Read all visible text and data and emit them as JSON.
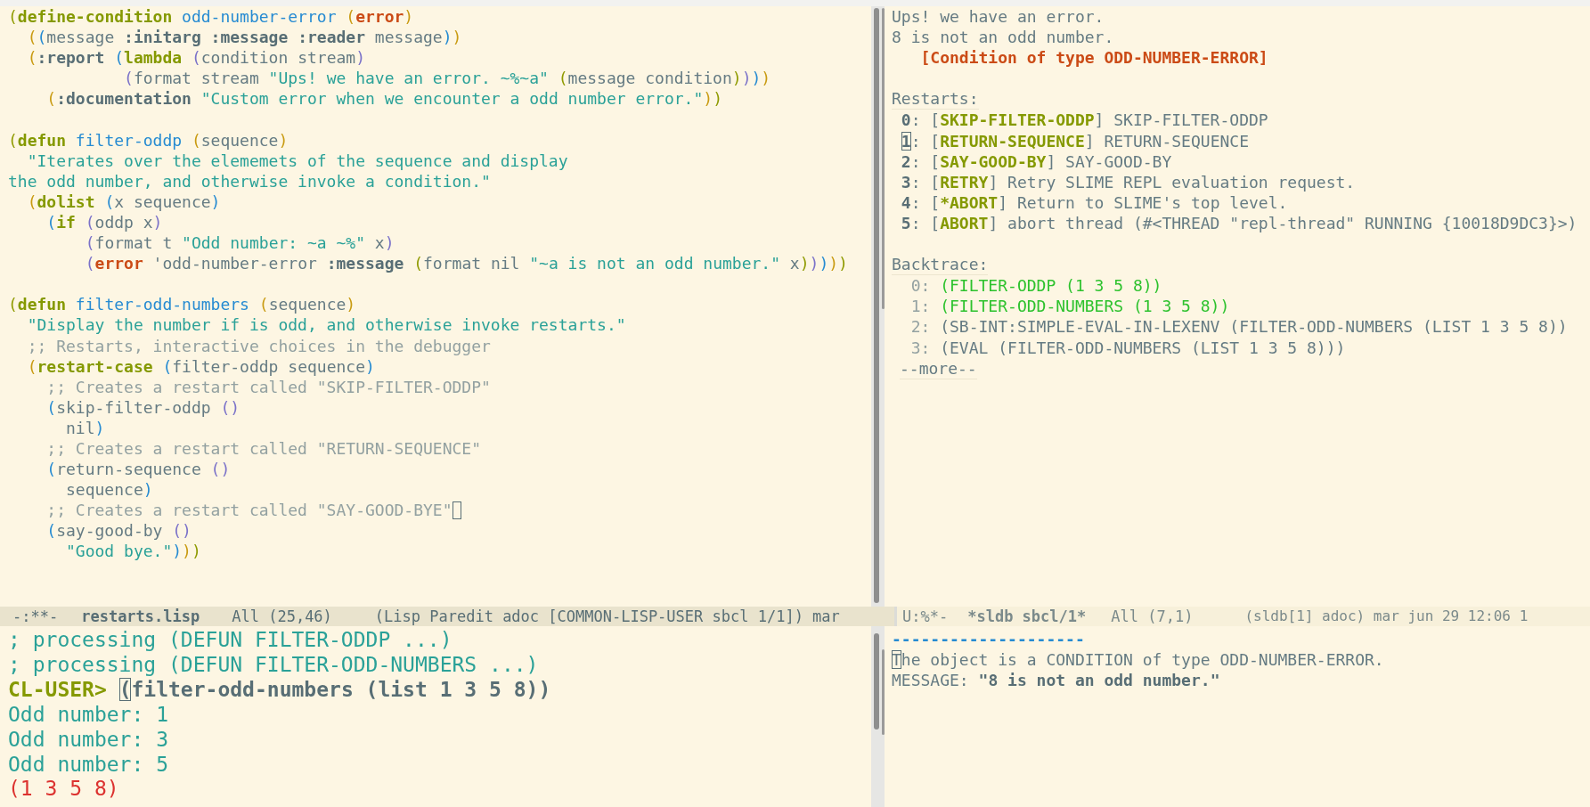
{
  "editor": {
    "lines": [
      {
        "kind": "code",
        "segments": [
          {
            "text": "(",
            "kind": "p1"
          },
          {
            "text": "define-condition",
            "kind": "kw"
          },
          {
            "text": " odd-number-error ",
            "kind": "fn"
          },
          {
            "text": "(",
            "kind": "p2"
          },
          {
            "text": "error",
            "kind": "err"
          },
          {
            "text": ")",
            "kind": "p2"
          }
        ]
      },
      {
        "kind": "code",
        "segments": [
          {
            "text": "  (",
            "kind": "p2"
          },
          {
            "text": "(",
            "kind": "p3"
          },
          {
            "text": "message ",
            "kind": "p"
          },
          {
            "text": ":initarg :message :reader",
            "kind": "key"
          },
          {
            "text": " message",
            "kind": "p"
          },
          {
            "text": ")",
            "kind": "p3"
          },
          {
            "text": ")",
            "kind": "p2"
          }
        ]
      },
      {
        "kind": "code",
        "segments": [
          {
            "text": "  (",
            "kind": "p2"
          },
          {
            "text": ":report ",
            "kind": "key"
          },
          {
            "text": "(",
            "kind": "p3"
          },
          {
            "text": "lambda ",
            "kind": "kw"
          },
          {
            "text": "(",
            "kind": "p4"
          },
          {
            "text": "condition stream",
            "kind": "p"
          },
          {
            "text": ")",
            "kind": "p4"
          }
        ]
      },
      {
        "kind": "code",
        "segments": [
          {
            "text": "            (",
            "kind": "p4"
          },
          {
            "text": "format stream ",
            "kind": "p"
          },
          {
            "text": "\"Ups! we have an error. ~%~a\" ",
            "kind": "str"
          },
          {
            "text": "(",
            "kind": "p1"
          },
          {
            "text": "message condition",
            "kind": "p"
          },
          {
            "text": ")",
            "kind": "p1"
          },
          {
            "text": ")",
            "kind": "p4"
          },
          {
            "text": ")",
            "kind": "p3"
          },
          {
            "text": ")",
            "kind": "p2"
          }
        ]
      },
      {
        "kind": "code",
        "segments": [
          {
            "text": "    (",
            "kind": "p2"
          },
          {
            "text": ":documentation ",
            "kind": "key"
          },
          {
            "text": "\"Custom error when we encounter a odd number error.\"",
            "kind": "str"
          },
          {
            "text": ")",
            "kind": "p2"
          },
          {
            "text": ")",
            "kind": "p1"
          }
        ]
      },
      {
        "kind": "blank"
      },
      {
        "kind": "code",
        "segments": [
          {
            "text": "(",
            "kind": "p1"
          },
          {
            "text": "defun",
            "kind": "kw"
          },
          {
            "text": " filter-oddp ",
            "kind": "fn"
          },
          {
            "text": "(",
            "kind": "p2"
          },
          {
            "text": "sequence",
            "kind": "p"
          },
          {
            "text": ")",
            "kind": "p2"
          }
        ]
      },
      {
        "kind": "code",
        "segments": [
          {
            "text": "  \"Iterates over the elememets of the sequence and display",
            "kind": "str"
          }
        ]
      },
      {
        "kind": "code",
        "segments": [
          {
            "text": "the odd number, and otherwise invoke a condition.\"",
            "kind": "str"
          }
        ]
      },
      {
        "kind": "code",
        "segments": [
          {
            "text": "  (",
            "kind": "p2"
          },
          {
            "text": "dolist ",
            "kind": "kw"
          },
          {
            "text": "(",
            "kind": "p3"
          },
          {
            "text": "x sequence",
            "kind": "p"
          },
          {
            "text": ")",
            "kind": "p3"
          }
        ]
      },
      {
        "kind": "code",
        "segments": [
          {
            "text": "    (",
            "kind": "p3"
          },
          {
            "text": "if ",
            "kind": "kw"
          },
          {
            "text": "(",
            "kind": "p4"
          },
          {
            "text": "oddp x",
            "kind": "p"
          },
          {
            "text": ")",
            "kind": "p4"
          }
        ]
      },
      {
        "kind": "code",
        "segments": [
          {
            "text": "        (",
            "kind": "p4"
          },
          {
            "text": "format t ",
            "kind": "p"
          },
          {
            "text": "\"Odd number: ~a ~%\"",
            "kind": "str"
          },
          {
            "text": " x",
            "kind": "p"
          },
          {
            "text": ")",
            "kind": "p4"
          }
        ]
      },
      {
        "kind": "code",
        "segments": [
          {
            "text": "        (",
            "kind": "p4"
          },
          {
            "text": "error",
            "kind": "err"
          },
          {
            "text": " 'odd-number-error ",
            "kind": "p"
          },
          {
            "text": ":message ",
            "kind": "key"
          },
          {
            "text": "(",
            "kind": "p1"
          },
          {
            "text": "format nil ",
            "kind": "p"
          },
          {
            "text": "\"~a is not an odd number.\"",
            "kind": "str"
          },
          {
            "text": " x",
            "kind": "p"
          },
          {
            "text": ")",
            "kind": "p1"
          },
          {
            "text": ")",
            "kind": "p4"
          },
          {
            "text": ")",
            "kind": "p3"
          },
          {
            "text": ")",
            "kind": "p2"
          },
          {
            "text": ")",
            "kind": "p1"
          }
        ]
      },
      {
        "kind": "blank"
      },
      {
        "kind": "code",
        "segments": [
          {
            "text": "(",
            "kind": "p1"
          },
          {
            "text": "defun",
            "kind": "kw"
          },
          {
            "text": " filter-odd-numbers ",
            "kind": "fn"
          },
          {
            "text": "(",
            "kind": "p2"
          },
          {
            "text": "sequence",
            "kind": "p"
          },
          {
            "text": ")",
            "kind": "p2"
          }
        ]
      },
      {
        "kind": "code",
        "segments": [
          {
            "text": "  \"Display the number if is odd, and otherwise invoke restarts.\"",
            "kind": "str"
          }
        ]
      },
      {
        "kind": "code",
        "segments": [
          {
            "text": "  ;; Restarts, interactive choices in the debugger",
            "kind": "cm"
          }
        ]
      },
      {
        "kind": "code",
        "segments": [
          {
            "text": "  (",
            "kind": "p2"
          },
          {
            "text": "restart-case ",
            "kind": "kw"
          },
          {
            "text": "(",
            "kind": "p3"
          },
          {
            "text": "filter-oddp sequence",
            "kind": "p"
          },
          {
            "text": ")",
            "kind": "p3"
          }
        ]
      },
      {
        "kind": "code",
        "segments": [
          {
            "text": "    ;; Creates a restart called \"SKIP-FILTER-ODDP\"",
            "kind": "cm"
          }
        ]
      },
      {
        "kind": "code",
        "segments": [
          {
            "text": "    (",
            "kind": "p3"
          },
          {
            "text": "skip-filter-oddp ",
            "kind": "p"
          },
          {
            "text": "()",
            "kind": "p4"
          }
        ]
      },
      {
        "kind": "code",
        "segments": [
          {
            "text": "      nil",
            "kind": "p"
          },
          {
            "text": ")",
            "kind": "p3"
          }
        ]
      },
      {
        "kind": "code",
        "segments": [
          {
            "text": "    ;; Creates a restart called \"RETURN-SEQUENCE\"",
            "kind": "cm"
          }
        ]
      },
      {
        "kind": "code",
        "segments": [
          {
            "text": "    (",
            "kind": "p3"
          },
          {
            "text": "return-sequence ",
            "kind": "p"
          },
          {
            "text": "()",
            "kind": "p4"
          }
        ]
      },
      {
        "kind": "code",
        "segments": [
          {
            "text": "      sequence",
            "kind": "p"
          },
          {
            "text": ")",
            "kind": "p3"
          }
        ]
      },
      {
        "kind": "code",
        "cursor_after": true,
        "segments": [
          {
            "text": "    ;; Creates a restart called \"SAY-GOOD-BYE\"",
            "kind": "cm"
          }
        ]
      },
      {
        "kind": "code",
        "segments": [
          {
            "text": "    (",
            "kind": "p3"
          },
          {
            "text": "say-good-by ",
            "kind": "p"
          },
          {
            "text": "()",
            "kind": "p4"
          }
        ]
      },
      {
        "kind": "code",
        "segments": [
          {
            "text": "      \"Good bye.\"",
            "kind": "str"
          },
          {
            "text": ")",
            "kind": "p3"
          },
          {
            "text": ")",
            "kind": "p2"
          },
          {
            "text": ")",
            "kind": "p1"
          }
        ]
      }
    ]
  },
  "debugger": {
    "lines": [
      {
        "kind": "text",
        "segments": [
          {
            "text": "Ups! we have an error.",
            "kind": "p"
          }
        ]
      },
      {
        "kind": "text",
        "segments": [
          {
            "text": "8 is not an odd number.",
            "kind": "p"
          }
        ]
      },
      {
        "kind": "text",
        "segments": [
          {
            "text": "   [Condition of type ODD-NUMBER-ERROR]",
            "kind": "cond"
          }
        ]
      },
      {
        "kind": "blank"
      },
      {
        "kind": "heading",
        "segments": [
          {
            "text": "Restarts:",
            "kind": "p"
          }
        ]
      },
      {
        "kind": "restart",
        "segments": [
          {
            "text": "0",
            "kind": "num"
          },
          {
            "text": ": [",
            "kind": "p"
          },
          {
            "text": "SKIP-FILTER-ODDP",
            "kind": "rname"
          },
          {
            "text": "] SKIP-FILTER-ODDP",
            "kind": "p"
          }
        ]
      },
      {
        "kind": "restart",
        "segments": [
          {
            "text": "1",
            "kind": "curb"
          },
          {
            "text": ": [",
            "kind": "p"
          },
          {
            "text": "RETURN-SEQUENCE",
            "kind": "rname"
          },
          {
            "text": "] RETURN-SEQUENCE",
            "kind": "p"
          }
        ]
      },
      {
        "kind": "restart",
        "segments": [
          {
            "text": "2",
            "kind": "num"
          },
          {
            "text": ": [",
            "kind": "p"
          },
          {
            "text": "SAY-GOOD-BY",
            "kind": "rname"
          },
          {
            "text": "] SAY-GOOD-BY",
            "kind": "p"
          }
        ]
      },
      {
        "kind": "restart",
        "segments": [
          {
            "text": "3",
            "kind": "num"
          },
          {
            "text": ": [",
            "kind": "p"
          },
          {
            "text": "RETRY",
            "kind": "rname"
          },
          {
            "text": "] Retry SLIME REPL evaluation request.",
            "kind": "p"
          }
        ]
      },
      {
        "kind": "restart",
        "segments": [
          {
            "text": "4",
            "kind": "num"
          },
          {
            "text": ": [",
            "kind": "p"
          },
          {
            "text": "*ABORT",
            "kind": "rname"
          },
          {
            "text": "] Return to SLIME's top level.",
            "kind": "p"
          }
        ]
      },
      {
        "kind": "restart",
        "segments": [
          {
            "text": "5",
            "kind": "num"
          },
          {
            "text": ": [",
            "kind": "p"
          },
          {
            "text": "ABORT",
            "kind": "rname"
          },
          {
            "text": "] abort thread (#<THREAD \"repl-thread\" RUNNING {10018D9DC3}>)",
            "kind": "p"
          }
        ]
      },
      {
        "kind": "blank"
      },
      {
        "kind": "heading",
        "segments": [
          {
            "text": "Backtrace:",
            "kind": "p"
          }
        ]
      },
      {
        "kind": "frame",
        "segments": [
          {
            "text": "  0: ",
            "kind": "fnum"
          },
          {
            "text": "(FILTER-ODDP (1 3 5 8))",
            "kind": "live"
          }
        ]
      },
      {
        "kind": "frame",
        "segments": [
          {
            "text": "  1: ",
            "kind": "fnum"
          },
          {
            "text": "(FILTER-ODD-NUMBERS (1 3 5 8))",
            "kind": "live"
          }
        ]
      },
      {
        "kind": "frame",
        "segments": [
          {
            "text": "  2: ",
            "kind": "fnum"
          },
          {
            "text": "(SB-INT:SIMPLE-EVAL-IN-LEXENV (FILTER-ODD-NUMBERS (LIST 1 3 5 8))",
            "kind": "p"
          }
        ]
      },
      {
        "kind": "frame",
        "segments": [
          {
            "text": "  3: ",
            "kind": "fnum"
          },
          {
            "text": "(EVAL (FILTER-ODD-NUMBERS (LIST 1 3 5 8)))",
            "kind": "p"
          }
        ]
      },
      {
        "kind": "more",
        "segments": [
          {
            "text": "--more--",
            "kind": "p"
          }
        ]
      }
    ]
  },
  "editor_mode_line": {
    "active": true,
    "state": "-:**-",
    "buffer": "restarts.lisp",
    "position": "All (25,46)",
    "modes": "(Lisp Paredit adoc [COMMON-LISP-USER sbcl 1/1]) mar"
  },
  "debugger_mode_line": {
    "active": false,
    "state": "U:%*-",
    "buffer": "*sldb sbcl/1*",
    "position": "All (7,1)",
    "modes": "(sldb[1] adoc) mar jun 29 12:06 1"
  },
  "repl": {
    "lines": [
      {
        "segments": [
          {
            "text": "; processing (DEFUN FILTER-ODDP ...)",
            "kind": "out"
          }
        ]
      },
      {
        "segments": [
          {
            "text": "; processing (DEFUN FILTER-ODD-NUMBERS ...)",
            "kind": "out"
          }
        ]
      },
      {
        "segments": [
          {
            "text": "CL-USER> ",
            "kind": "prompt"
          },
          {
            "text": "(",
            "kind": "curb"
          },
          {
            "text": "filter-odd-numbers (list 1 3 5 8))",
            "kind": "input"
          }
        ]
      },
      {
        "segments": [
          {
            "text": "Odd number: 1",
            "kind": "out"
          }
        ]
      },
      {
        "segments": [
          {
            "text": "Odd number: 3",
            "kind": "out"
          }
        ]
      },
      {
        "segments": [
          {
            "text": "Odd number: 5",
            "kind": "out"
          }
        ]
      },
      {
        "segments": [
          {
            "text": "(1 3 5 8)",
            "kind": "result"
          }
        ]
      }
    ]
  },
  "inspector": {
    "lines": [
      {
        "segments": [
          {
            "text": "--------------------",
            "kind": "rule"
          }
        ]
      },
      {
        "segments": [
          {
            "text": "T",
            "kind": "cur"
          },
          {
            "text": "he object is a CONDITION of type ODD-NUMBER-ERROR.",
            "kind": "p"
          }
        ]
      },
      {
        "segments": [
          {
            "text": "MESSAGE: ",
            "kind": "p"
          },
          {
            "text": "\"8 is not an odd number.\"",
            "kind": "val"
          }
        ]
      }
    ]
  }
}
